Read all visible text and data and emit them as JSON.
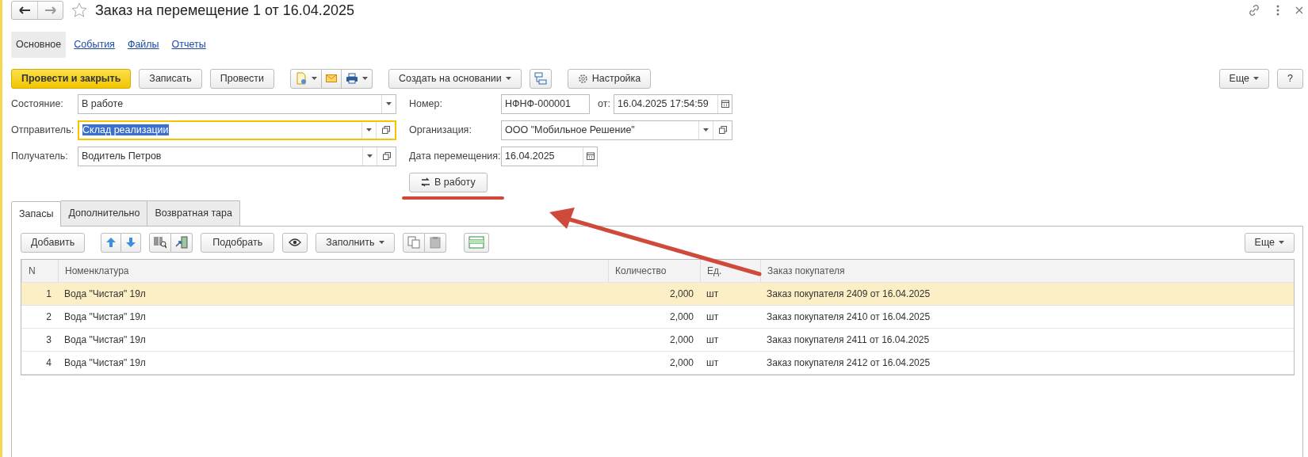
{
  "window": {
    "title": "Заказ на перемещение 1 от 16.04.2025",
    "favorite": false
  },
  "sections": [
    {
      "label": "Основное",
      "selected": true
    },
    {
      "label": "События",
      "selected": false
    },
    {
      "label": "Файлы",
      "selected": false
    },
    {
      "label": "Отчеты",
      "selected": false
    }
  ],
  "command_bar": {
    "buttons": [
      {
        "label": "Провести и закрыть",
        "kind": "primary"
      },
      {
        "label": "Записать",
        "kind": "plain"
      },
      {
        "label": "Провести",
        "kind": "plain"
      }
    ],
    "create_based_on": "Создать на основании",
    "settings": "Настройка",
    "more": "Еще",
    "help": "?"
  },
  "fields_left": [
    {
      "label": "Состояние:",
      "value": "В работе",
      "focused": false,
      "open_button": false
    },
    {
      "label": "Отправитель:",
      "value": "Склад реализации",
      "focused": true,
      "open_button": true
    },
    {
      "label": "Получатель:",
      "value": "Водитель Петров",
      "focused": false,
      "open_button": true
    }
  ],
  "number": {
    "label": "Номер:",
    "value": "НФНФ-000001",
    "date_label": "от:",
    "date": "16.04.2025 17:54:59"
  },
  "organization": {
    "label": "Организация:",
    "value": "ООО \"Мобильное Решение\""
  },
  "move_date": {
    "label": "Дата перемещения:",
    "value": "16.04.2025"
  },
  "status_button": "В работу",
  "tabs": [
    {
      "label": "Запасы",
      "selected": true
    },
    {
      "label": "Дополнительно",
      "selected": false
    },
    {
      "label": "Возвратная тара",
      "selected": false
    }
  ],
  "table_toolbar": {
    "add": "Добавить",
    "pick": "Подобрать",
    "fill": "Заполнить",
    "more": "Еще"
  },
  "table": {
    "columns": [
      "N",
      "Номенклатура",
      "Количество",
      "Ед.",
      "Заказ покупателя"
    ],
    "rows": [
      {
        "cells": [
          "1",
          "Вода \"Чистая\" 19л",
          "2,000",
          "шт",
          "Заказ покупателя 2409 от 16.04.2025"
        ],
        "selected": true
      },
      {
        "cells": [
          "2",
          "Вода \"Чистая\" 19л",
          "2,000",
          "шт",
          "Заказ покупателя 2410 от 16.04.2025"
        ],
        "selected": false
      },
      {
        "cells": [
          "3",
          "Вода \"Чистая\" 19л",
          "2,000",
          "шт",
          "Заказ покупателя 2411 от 16.04.2025"
        ],
        "selected": false
      },
      {
        "cells": [
          "4",
          "Вода \"Чистая\" 19л",
          "2,000",
          "шт",
          "Заказ покупателя 2412 от 16.04.2025"
        ],
        "selected": false
      }
    ]
  }
}
